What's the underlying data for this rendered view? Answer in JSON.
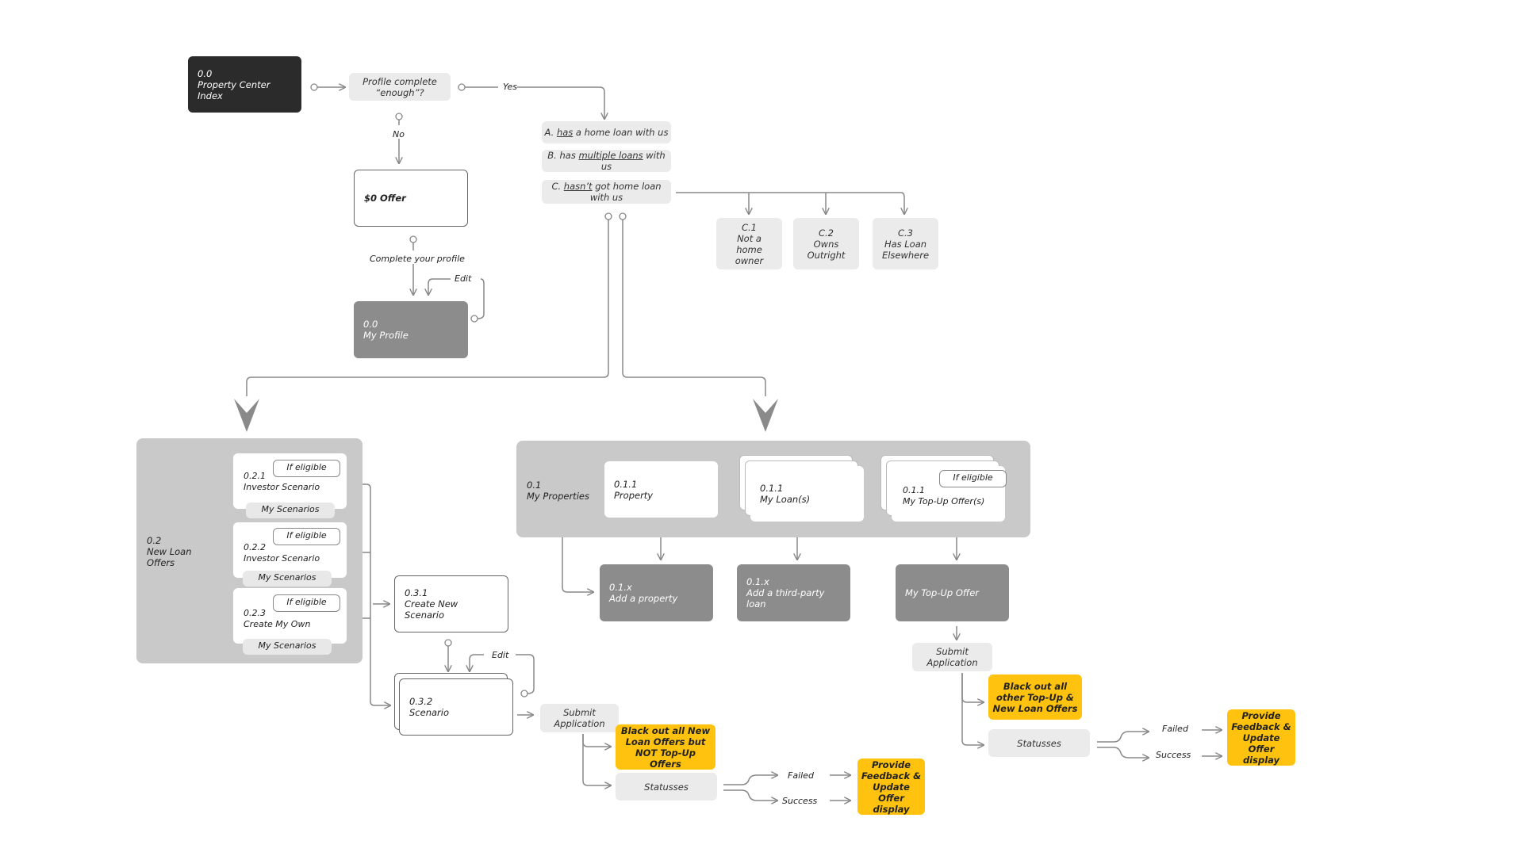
{
  "colors": {
    "dark_node": "#2b2b2b",
    "mid_node": "#8c8c8c",
    "light_node": "#ebebeb",
    "group_bg": "#c9c9c9",
    "highlight": "#ffc20e",
    "connector": "#888888"
  },
  "start": {
    "id": "0.0",
    "title": "Property Center Index"
  },
  "decision": {
    "text": "Profile complete “enough”?",
    "yes_label": "Yes",
    "no_label": "No"
  },
  "zero_offer": {
    "title": "$0 Offer",
    "link_label": "Complete your profile",
    "edit_label": "Edit"
  },
  "my_profile": {
    "id": "0.0",
    "title": "My Profile"
  },
  "segments": [
    {
      "prefix": "A.",
      "emph": "has",
      "rest": " a home loan with us"
    },
    {
      "prefix": "B. has",
      "emph": "multiple loans",
      "rest": " with us"
    },
    {
      "prefix": "C.",
      "emph": "hasn’t",
      "rest": " got home loan with us"
    }
  ],
  "c_types": [
    {
      "id": "C.1",
      "title": "Not a home owner"
    },
    {
      "id": "C.2",
      "title": "Owns Outright"
    },
    {
      "id": "C.3",
      "title": "Has Loan Elsewhere"
    }
  ],
  "new_loan_offers": {
    "id": "0.2",
    "title": "New Loan Offers",
    "items": [
      {
        "id": "0.2.1",
        "title": "Investor Scenario",
        "badge": "If eligible",
        "tab": "My Scenarios"
      },
      {
        "id": "0.2.2",
        "title": "Investor Scenario",
        "badge": "If eligible",
        "tab": "My Scenarios"
      },
      {
        "id": "0.2.3",
        "title": "Create My Own",
        "badge": "If eligible",
        "tab": "My Scenarios"
      }
    ]
  },
  "scenario_flow": {
    "create": {
      "id": "0.3.1",
      "title": "Create New Scenario"
    },
    "scenario": {
      "id": "0.3.2",
      "title": "Scenario"
    },
    "edit_label": "Edit",
    "submit": "Submit Application",
    "blackout": "Black out all New Loan Offers but NOT Top-Up Offers",
    "statuses": "Statusses",
    "failed": "Failed",
    "success": "Success",
    "feedback": "Provide Feedback & Update Offer display"
  },
  "my_properties": {
    "id": "0.1",
    "title": "My Properties",
    "property": {
      "id": "0.1.1",
      "title": "Property"
    },
    "loans": {
      "id": "0.1.1",
      "title": "My Loan(s)"
    },
    "topups": {
      "id": "0.1.1",
      "title": "My Top-Up Offer(s)",
      "badge": "If eligible"
    },
    "add_property": {
      "id": "0.1.x",
      "title": "Add a property"
    },
    "add_loan": {
      "id": "0.1.x",
      "title": "Add a third-party loan"
    },
    "topup_offer": {
      "title": "My Top-Up Offer"
    }
  },
  "topup_flow": {
    "submit": "Submit Application",
    "blackout": "Black out all other Top-Up & New Loan Offers",
    "statuses": "Statusses",
    "failed": "Failed",
    "success": "Success",
    "feedback": "Provide Feedback & Update Offer display"
  }
}
